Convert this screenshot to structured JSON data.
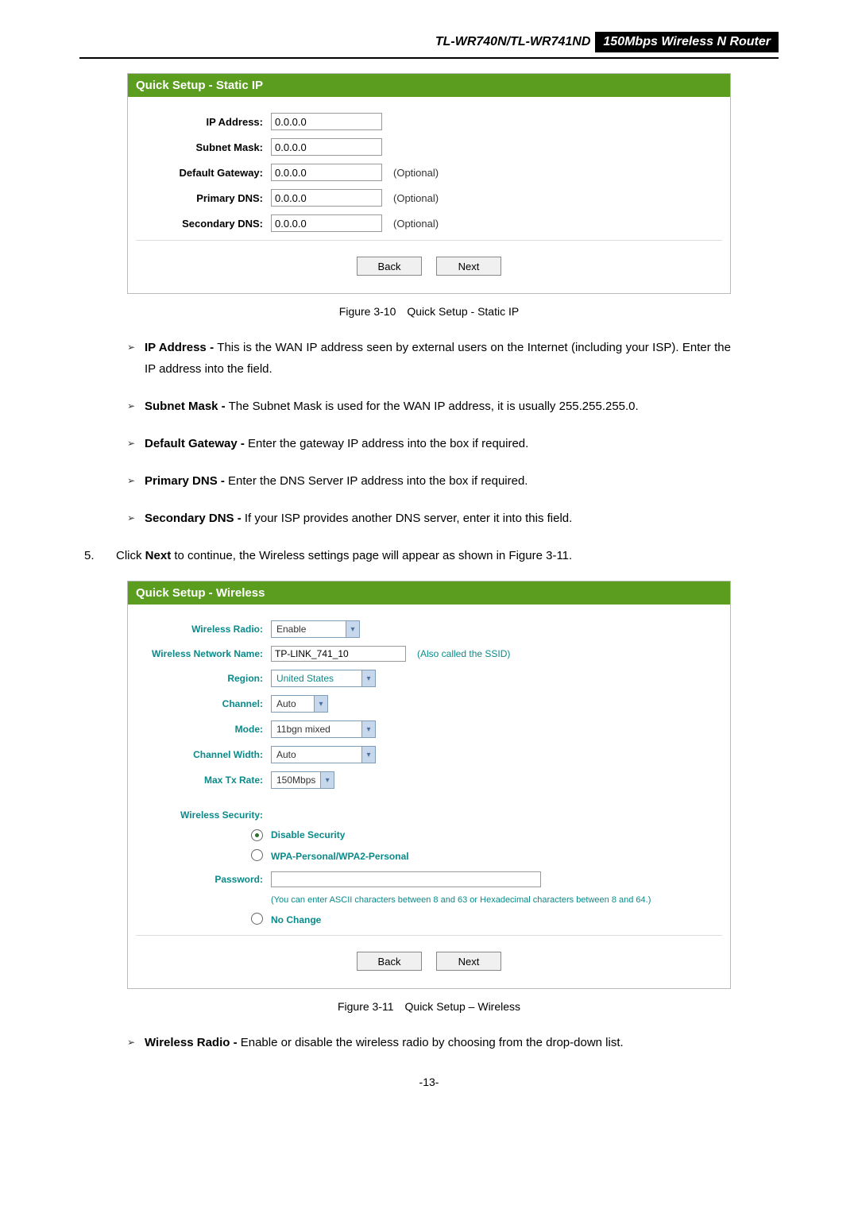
{
  "header": {
    "model": "TL-WR740N/TL-WR741ND",
    "product": "150Mbps Wireless N Router"
  },
  "panel1": {
    "title": "Quick Setup - Static IP",
    "fields": [
      {
        "label": "IP Address:",
        "value": "0.0.0.0",
        "note": ""
      },
      {
        "label": "Subnet Mask:",
        "value": "0.0.0.0",
        "note": ""
      },
      {
        "label": "Default Gateway:",
        "value": "0.0.0.0",
        "note": "(Optional)"
      },
      {
        "label": "Primary DNS:",
        "value": "0.0.0.0",
        "note": "(Optional)"
      },
      {
        "label": "Secondary DNS:",
        "value": "0.0.0.0",
        "note": "(Optional)"
      }
    ],
    "back": "Back",
    "next": "Next"
  },
  "caption1": "Figure 3-10 Quick Setup - Static IP",
  "bullets1": [
    {
      "bold": "IP Address -",
      "text": " This is the WAN IP address seen by external users on the Internet (including your ISP). Enter the IP address into the field."
    },
    {
      "bold": "Subnet Mask -",
      "text": " The Subnet Mask is used for the WAN IP address, it is usually 255.255.255.0."
    },
    {
      "bold": "Default Gateway -",
      "text": " Enter the gateway IP address into the box if required."
    },
    {
      "bold": "Primary DNS -",
      "text": " Enter the DNS Server IP address into the box if required."
    },
    {
      "bold": "Secondary DNS -",
      "text": " If your ISP provides another DNS server, enter it into this field."
    }
  ],
  "step5": {
    "num": "5.",
    "before": "Click ",
    "bold": "Next",
    "after": " to continue, the Wireless settings page will appear as shown in Figure 3-11."
  },
  "panel2": {
    "title": "Quick Setup - Wireless",
    "wireless_radio": {
      "label": "Wireless Radio:",
      "value": "Enable"
    },
    "network_name": {
      "label": "Wireless Network Name:",
      "value": "TP-LINK_741_10",
      "note": "(Also called the SSID)"
    },
    "region": {
      "label": "Region:",
      "value": "United States"
    },
    "channel": {
      "label": "Channel:",
      "value": "Auto"
    },
    "mode": {
      "label": "Mode:",
      "value": "11bgn mixed"
    },
    "channel_width": {
      "label": "Channel Width:",
      "value": "Auto"
    },
    "max_tx": {
      "label": "Max Tx Rate:",
      "value": "150Mbps"
    },
    "security_label": "Wireless Security:",
    "opt1": "Disable Security",
    "opt2": "WPA-Personal/WPA2-Personal",
    "password_label": "Password:",
    "hint": "(You can enter ASCII characters between 8 and 63 or Hexadecimal characters between 8 and 64.)",
    "opt3": "No Change",
    "back": "Back",
    "next": "Next"
  },
  "caption2": "Figure 3-11 Quick Setup – Wireless",
  "bullets2": [
    {
      "bold": "Wireless Radio -",
      "text": " Enable or disable the wireless radio by choosing from the drop-down list."
    }
  ],
  "page_number": "-13-"
}
